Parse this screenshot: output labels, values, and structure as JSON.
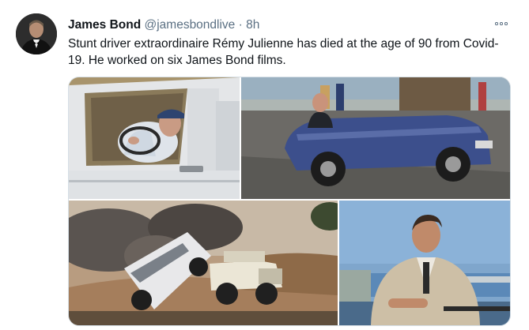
{
  "tweet": {
    "author_name": "James Bond",
    "handle": "@jamesbondlive",
    "separator": "·",
    "time": "8h",
    "text": "Stunt driver extraordinaire Rémy Julienne has died at the age of 90 from Covid-19. He worked on six James Bond films.",
    "more_icon": "ellipsis-icon",
    "avatar_icon": "avatar"
  },
  "media": {
    "photo_count": 4
  }
}
